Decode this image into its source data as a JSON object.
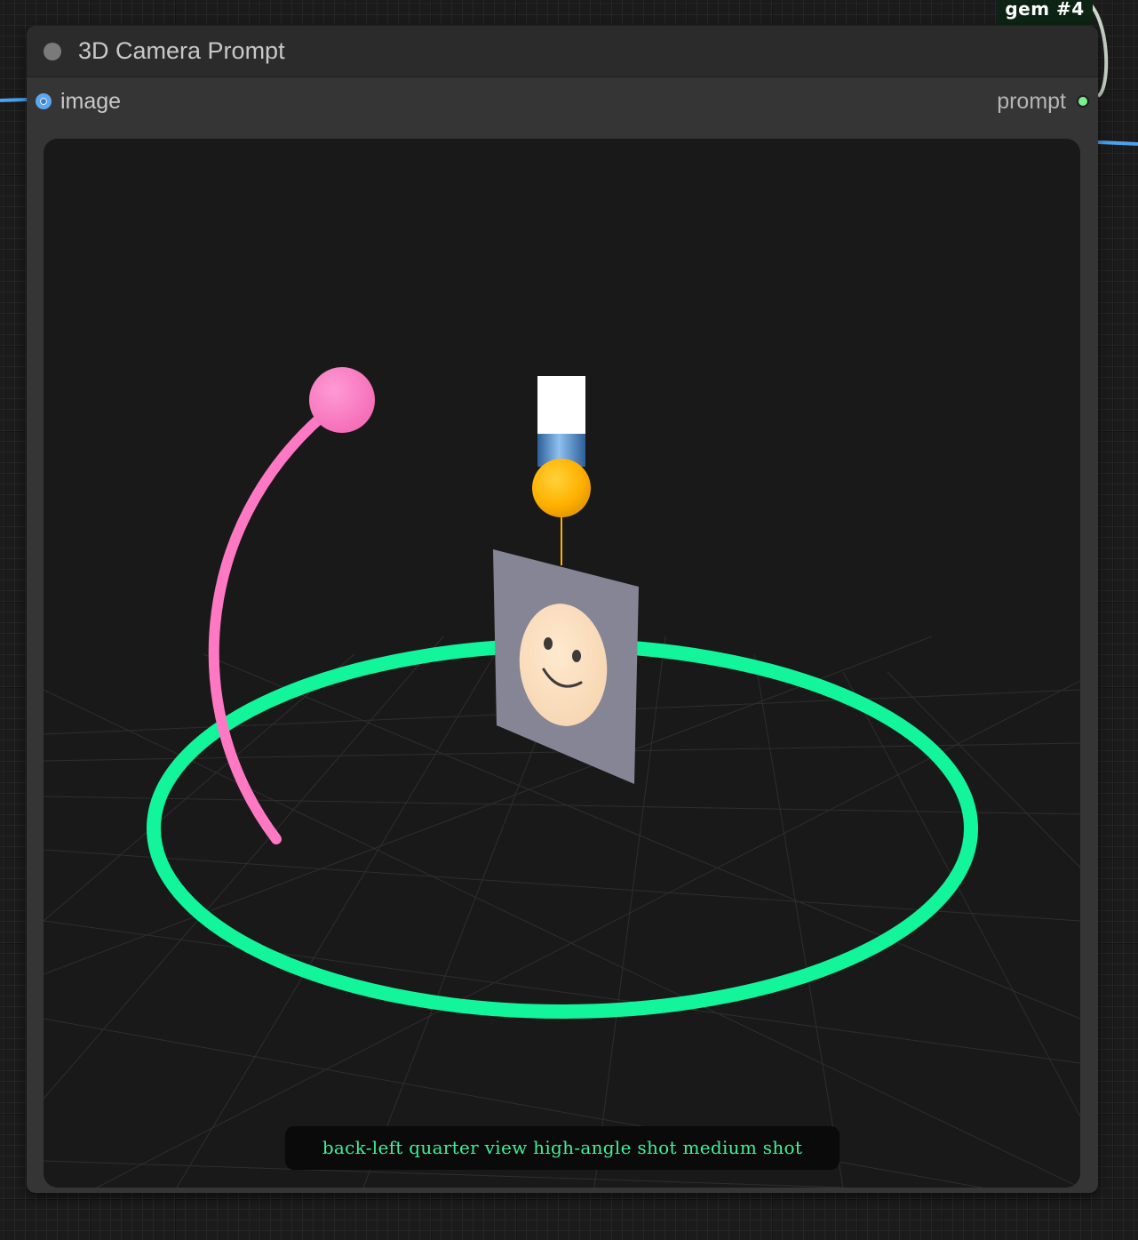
{
  "badge": {
    "label": "gem  #4"
  },
  "node": {
    "title": "3D Camera Prompt",
    "inputs": [
      {
        "label": "image",
        "color": "#5aa8ee"
      }
    ],
    "outputs": [
      {
        "label": "prompt",
        "color": "#7cf08c"
      }
    ]
  },
  "viewport": {
    "prompt_text": "back-left quarter view high-angle shot medium shot",
    "colors": {
      "azimuth_ring": "#12f59a",
      "elevation_arc": "#ff78c4",
      "camera_body": "#ffffff",
      "lens": "#4a86c6",
      "distance_handle": "#ffb800",
      "target_plane": "#868595",
      "face": "#fde1c2"
    },
    "icons": [
      "camera-icon",
      "smiley-face-icon"
    ]
  }
}
